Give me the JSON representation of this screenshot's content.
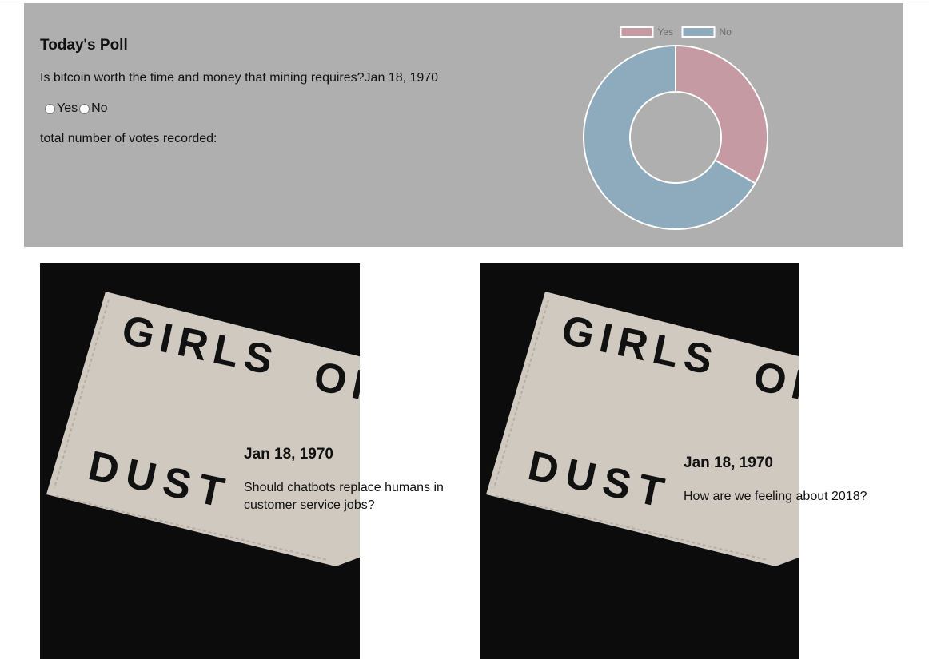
{
  "poll": {
    "title": "Today's Poll",
    "question": "Is bitcoin worth the time and money that mining requires?",
    "date": "Jan 18, 1970",
    "options": [
      {
        "label": "Yes"
      },
      {
        "label": "No"
      }
    ],
    "total_label": "total number of votes recorded:"
  },
  "chart_data": {
    "type": "pie",
    "variant": "doughnut",
    "labels": [
      "Yes",
      "No"
    ],
    "values": [
      1,
      2
    ],
    "colors": [
      "#c59aa3",
      "#8eabbd"
    ],
    "legend_position": "top"
  },
  "cards": [
    {
      "date": "Jan 18, 1970",
      "title": "Should chatbots replace humans in customer service jobs?",
      "image_text": [
        "GIRLS",
        "OF",
        "DUST"
      ]
    },
    {
      "date": "Jan 18, 1970",
      "title": "How are we feeling about 2018?",
      "image_text": [
        "GIRLS",
        "OF",
        "DUST"
      ]
    }
  ]
}
